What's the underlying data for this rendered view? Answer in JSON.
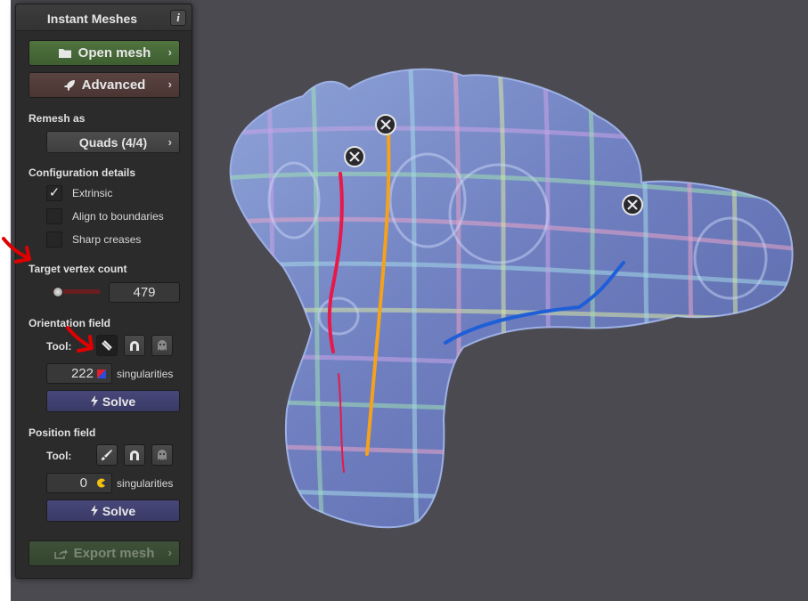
{
  "window": {
    "title": "Instant Meshes",
    "info_label": "i"
  },
  "buttons": {
    "open_mesh": "Open mesh",
    "advanced": "Advanced",
    "export_mesh": "Export mesh",
    "chevron": "›"
  },
  "remesh": {
    "heading": "Remesh as",
    "value": "Quads (4/4)"
  },
  "config": {
    "heading": "Configuration details",
    "options": [
      {
        "label": "Extrinsic",
        "checked": true,
        "mark": "✓"
      },
      {
        "label": "Align to boundaries",
        "checked": false,
        "mark": ""
      },
      {
        "label": "Sharp creases",
        "checked": false,
        "mark": ""
      }
    ]
  },
  "target": {
    "heading": "Target vertex count",
    "value": "479",
    "slider_fraction": 0.05
  },
  "orientation": {
    "heading": "Orientation field",
    "tool_label": "Tool:",
    "singularities_count": "222",
    "singularities_label": "singularities",
    "solve_label": "Solve",
    "active_tool": "comb-icon"
  },
  "position": {
    "heading": "Position field",
    "tool_label": "Tool:",
    "singularities_count": "0",
    "singularities_label": "singularities",
    "solve_label": "Solve",
    "active_tool": "none"
  },
  "viewport": {
    "background": "#4b4a50",
    "constraint_marker_count": 3,
    "stroke_colors": [
      "#e8184a",
      "#f5a21a",
      "#1e5fd8"
    ]
  },
  "annotations": {
    "arrow_color": "#e00000",
    "count": 2
  },
  "colors": {
    "panel": "#2b2b2c",
    "open_button": "#4a6b3a",
    "advanced_button": "#533d3b",
    "solve_button": "#41416f"
  }
}
